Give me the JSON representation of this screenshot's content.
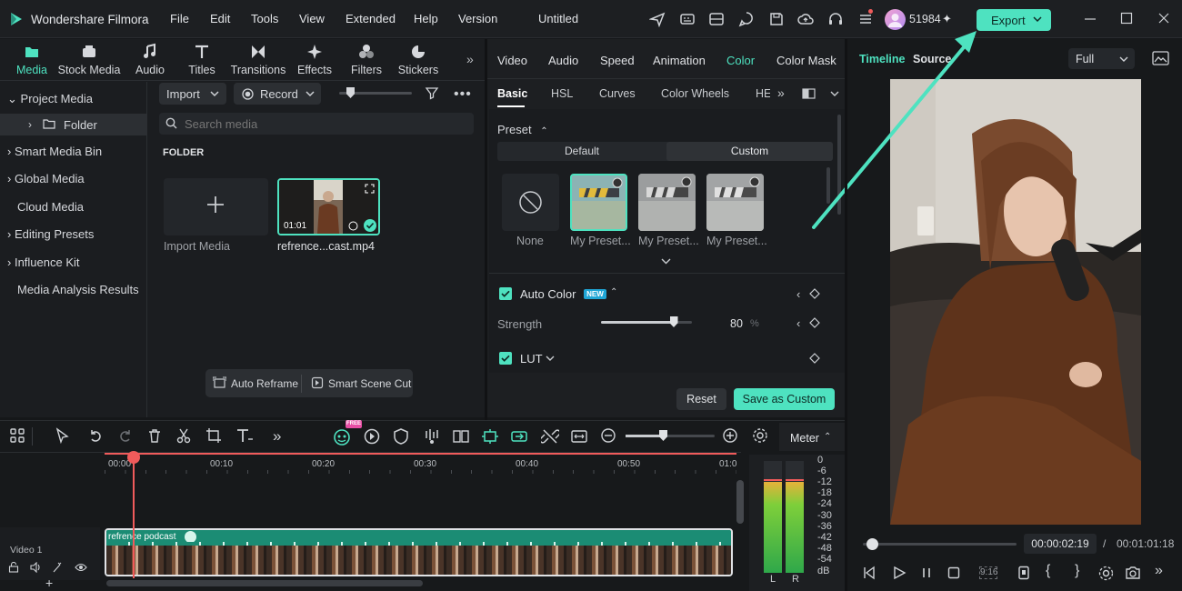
{
  "app": {
    "name": "Wondershare Filmora",
    "project_title": "Untitled",
    "menu": [
      "File",
      "Edit",
      "Tools",
      "View",
      "Extended",
      "Help",
      "Version"
    ],
    "credits": "51984",
    "export_label": "Export"
  },
  "toolbar_tabs": [
    "Media",
    "Stock Media",
    "Audio",
    "Titles",
    "Transitions",
    "Effects",
    "Filters",
    "Stickers"
  ],
  "sidebar": {
    "items": [
      {
        "label": "Project Media"
      },
      {
        "label": "Folder"
      },
      {
        "label": "Smart Media Bin"
      },
      {
        "label": "Global Media"
      },
      {
        "label": "Cloud Media"
      },
      {
        "label": "Editing Presets"
      },
      {
        "label": "Influence Kit"
      },
      {
        "label": "Media Analysis Results"
      }
    ]
  },
  "media": {
    "import_label": "Import",
    "record_label": "Record",
    "search_placeholder": "Search media",
    "folder_heading": "FOLDER",
    "import_media_label": "Import Media",
    "clip_name": "refrence...cast.mp4",
    "clip_duration": "01:01",
    "auto_reframe": "Auto Reframe",
    "smart_scene_cut": "Smart Scene Cut"
  },
  "properties": {
    "tabs": [
      "Video",
      "Audio",
      "Speed",
      "Animation",
      "Color",
      "Color Mask"
    ],
    "active_tab": "Color",
    "sub_tabs": [
      "Basic",
      "HSL",
      "Curves",
      "Color Wheels",
      "HE"
    ],
    "preset_label": "Preset",
    "preset_toggle": [
      "Default",
      "Custom"
    ],
    "presets": [
      "None",
      "My Preset...",
      "My Preset...",
      "My Preset..."
    ],
    "auto_color_label": "Auto Color",
    "new_badge": "NEW",
    "strength_label": "Strength",
    "strength_value": "80",
    "strength_unit": "%",
    "strength_fraction": 0.8,
    "lut_label": "LUT",
    "reset_label": "Reset",
    "save_custom_label": "Save as Custom"
  },
  "preview": {
    "tabs": [
      "Timeline",
      "Source"
    ],
    "quality": "Full",
    "current_time": "00:00:02:19",
    "separator": "/",
    "total_time": "00:01:01:18",
    "ratio_label": "9:16"
  },
  "timeline": {
    "free_badge": "FREE",
    "meter_label": "Meter",
    "ruler": [
      "00:00",
      "00:10",
      "00:20",
      "00:30",
      "00:40",
      "00:50",
      "01:0"
    ],
    "track_label": "Video 1",
    "clip_label": "refrence podcast",
    "meter_scale": [
      "0",
      "-6",
      "-12",
      "-18",
      "-24",
      "-30",
      "-36",
      "-42",
      "-48",
      "-54",
      "dB"
    ],
    "meter_channels": [
      "L",
      "R"
    ]
  },
  "colors": {
    "accent": "#4ee2c0",
    "export_bg": "#4ee2c0",
    "playhead": "#f05b5b",
    "clip": "#1b8c74"
  }
}
